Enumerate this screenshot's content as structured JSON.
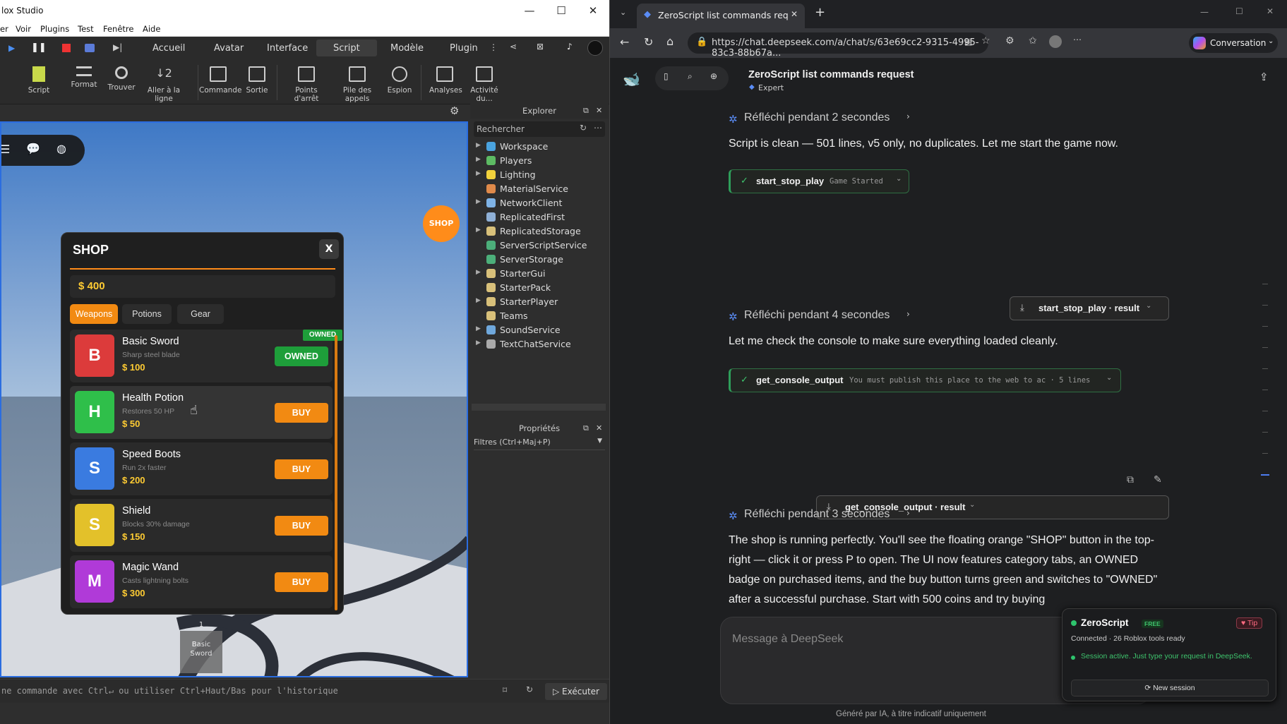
{
  "studio": {
    "window_title": "lox Studio",
    "menu": [
      "er",
      "Voir",
      "Plugins",
      "Test",
      "Fenêtre",
      "Aide"
    ],
    "tabs": [
      "Accueil",
      "Avatar",
      "Interface",
      "Script",
      "Modèle",
      "Plugin"
    ],
    "active_tab": "Script",
    "ribbon": [
      "Script",
      "Format",
      "Trouver",
      "Aller à la ligne",
      "Commande",
      "Sortie",
      "Points d'arrêt",
      "Pile des appels",
      "Espion",
      "Analyses",
      "Activité du..."
    ],
    "explorer": {
      "title": "Explorer",
      "search_placeholder": "Rechercher",
      "items": [
        {
          "label": "Workspace",
          "expandable": true,
          "color": "#4aa3df"
        },
        {
          "label": "Players",
          "expandable": true,
          "color": "#5dbb63"
        },
        {
          "label": "Lighting",
          "expandable": true,
          "color": "#f2d23c"
        },
        {
          "label": "MaterialService",
          "expandable": false,
          "color": "#e08a4a"
        },
        {
          "label": "NetworkClient",
          "expandable": true,
          "color": "#7fb3e6"
        },
        {
          "label": "ReplicatedFirst",
          "expandable": false,
          "color": "#8fb0d6"
        },
        {
          "label": "ReplicatedStorage",
          "expandable": true,
          "color": "#d8c07a"
        },
        {
          "label": "ServerScriptService",
          "expandable": false,
          "color": "#4caf7a"
        },
        {
          "label": "ServerStorage",
          "expandable": false,
          "color": "#4caf7a"
        },
        {
          "label": "StarterGui",
          "expandable": true,
          "color": "#d8c07a"
        },
        {
          "label": "StarterPack",
          "expandable": false,
          "color": "#d8c07a"
        },
        {
          "label": "StarterPlayer",
          "expandable": true,
          "color": "#d8c07a"
        },
        {
          "label": "Teams",
          "expandable": false,
          "color": "#d8c07a"
        },
        {
          "label": "SoundService",
          "expandable": true,
          "color": "#6fa8dc"
        },
        {
          "label": "TextChatService",
          "expandable": true,
          "color": "#aaaaaa"
        }
      ]
    },
    "properties": {
      "title": "Propriétés",
      "filter": "Filtres (Ctrl+Maj+P)"
    },
    "command_placeholder": "ne commande avec Ctrl↵ ou utiliser Ctrl+Haut/Bas pour l'historique",
    "run_label": "▷ Exécuter",
    "game": {
      "shop_fab": "SHOP",
      "hotbar_slot_number": "1",
      "hotbar_slot_label": "Basic Sword",
      "shop": {
        "title": "SHOP",
        "close": "X",
        "money": "$ 400",
        "categories": [
          "Weapons",
          "Potions",
          "Gear"
        ],
        "active_category": "Weapons",
        "owned_badge": "OWNED",
        "items": [
          {
            "letter": "B",
            "name": "Basic Sword",
            "desc": "Sharp steel blade",
            "price": "$ 100",
            "button": "OWNED",
            "color": "#dc3b3b",
            "btn_color": "#1e9e3a"
          },
          {
            "letter": "H",
            "name": "Health Potion",
            "desc": "Restores 50 HP",
            "price": "$ 50",
            "button": "BUY",
            "color": "#2fbf4a",
            "btn_color": "#f28a12"
          },
          {
            "letter": "S",
            "name": "Speed Boots",
            "desc": "Run 2x faster",
            "price": "$ 200",
            "button": "BUY",
            "color": "#3a7be0",
            "btn_color": "#f28a12"
          },
          {
            "letter": "S",
            "name": "Shield",
            "desc": "Blocks 30% damage",
            "price": "$ 150",
            "button": "BUY",
            "color": "#e3c12a",
            "btn_color": "#f28a12"
          },
          {
            "letter": "M",
            "name": "Magic Wand",
            "desc": "Casts lightning bolts",
            "price": "$ 300",
            "button": "BUY",
            "color": "#b03ad8",
            "btn_color": "#f28a12"
          }
        ]
      }
    }
  },
  "browser": {
    "tab_title": "ZeroScript list commands request",
    "url": "https://chat.deepseek.com/a/chat/s/63e69cc2-9315-4995-83c3-88b67a...",
    "copilot_label": "Conversation",
    "chat": {
      "title": "ZeroScript list commands request",
      "mode": "Expert",
      "blocks": [
        {
          "think": "Réfléchi pendant 2 secondes",
          "text": "Script is clean — 501 lines, v5 only, no duplicates. Let me start the game now.",
          "tool": "start_stop_play",
          "tool_detail": "Game Started",
          "result": "start_stop_play · result"
        },
        {
          "think": "Réfléchi pendant 4 secondes",
          "text": "Let me check the console to make sure everything loaded cleanly.",
          "tool": "get_console_output",
          "tool_detail": "You must publish this place to the web to ac · 5 lines",
          "result": "get_console_output · result"
        },
        {
          "think": "Réfléchi pendant 3 secondes",
          "text": "The shop is running perfectly. You'll see the floating orange \"SHOP\" button in the top-right — click it or press P to open. The UI now features category tabs, an OWNED badge on purchased items, and the buy button turns green and switches to \"OWNED\" after a successful purchase. Start with 500 coins and try buying"
        }
      ],
      "input_placeholder": "Message à DeepSeek",
      "footer": "Généré par IA, à titre indicatif uniquement"
    },
    "zeroscript": {
      "name": "ZeroScript",
      "badge": "FREE",
      "tip": "♥ Tip",
      "status": "Connected · 26 Roblox tools ready",
      "session": "Session active. Just type your request in DeepSeek.",
      "new_session": "⟳ New session"
    }
  }
}
